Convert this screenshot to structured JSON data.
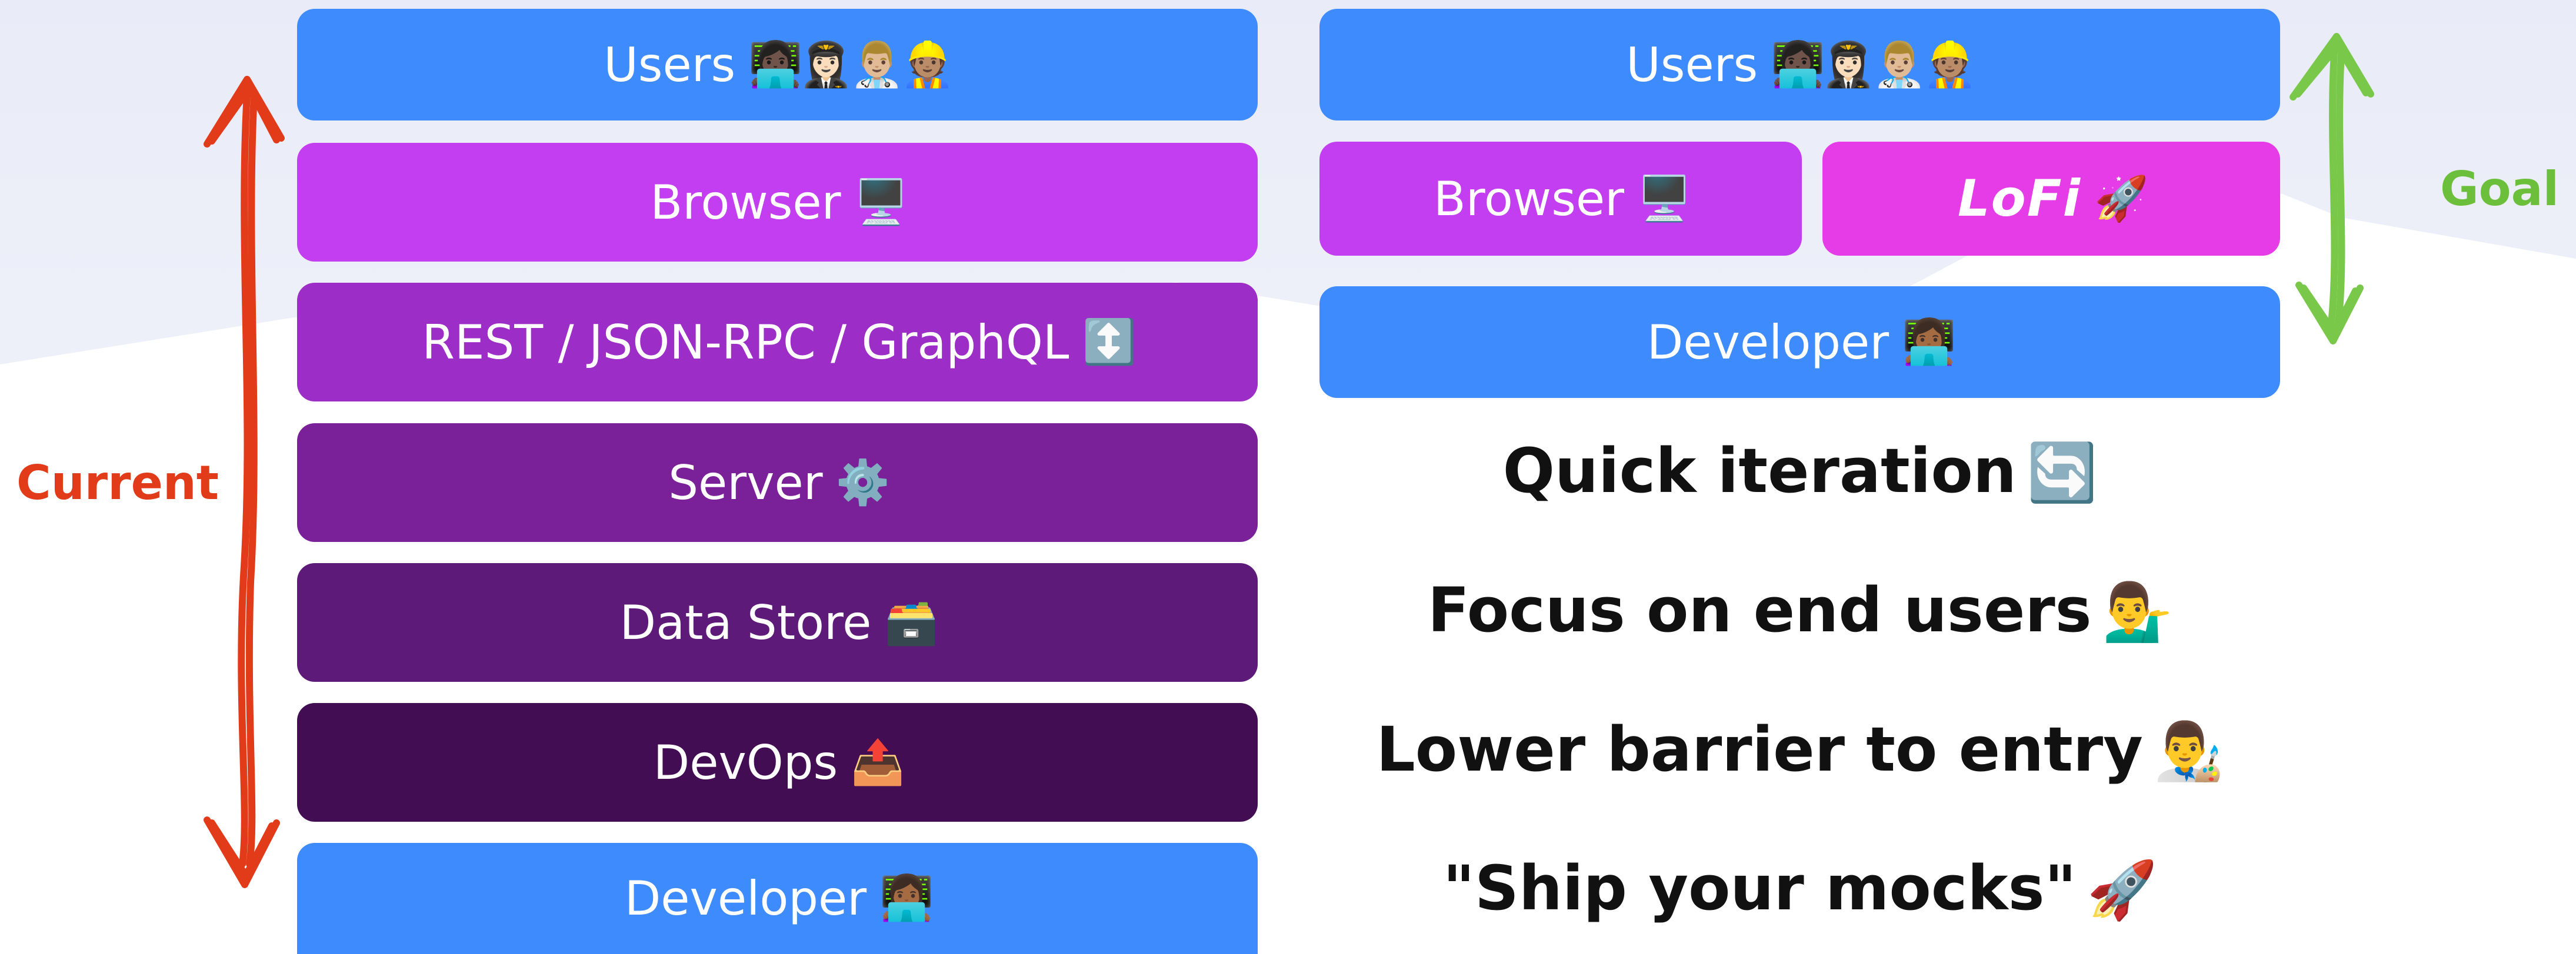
{
  "colors": {
    "blue": "#3d8bfd",
    "magenta": "#c23ef0",
    "violet_1": "#9c2ec7",
    "violet_2": "#7a2098",
    "violet_3": "#5e1a78",
    "violet_4": "#430d54",
    "pink": "#e63ce7",
    "current_red": "#e23b1a",
    "goal_green": "#6cbf3a"
  },
  "labels": {
    "current": "Current",
    "goal": "Goal"
  },
  "current_stack": [
    {
      "text": "Users",
      "emoji": "👩🏿‍💻👩🏻‍✈️👨🏼‍⚕️👷🏽"
    },
    {
      "text": "Browser",
      "emoji": "🖥️"
    },
    {
      "text": "REST / JSON-RPC / GraphQL",
      "emoji": "↕️"
    },
    {
      "text": "Server",
      "emoji": "⚙️"
    },
    {
      "text": "Data Store",
      "emoji": "🗃️"
    },
    {
      "text": "DevOps",
      "emoji": "📤"
    },
    {
      "text": "Developer",
      "emoji": "👩🏾‍💻"
    }
  ],
  "goal_stack": {
    "users": {
      "text": "Users",
      "emoji": "👩🏿‍💻👩🏻‍✈️👨🏼‍⚕️👷🏽"
    },
    "browser": {
      "text": "Browser",
      "emoji": "🖥️"
    },
    "lofi": {
      "text": "LoFi",
      "emoji": "🚀"
    },
    "developer": {
      "text": "Developer",
      "emoji": "👩🏾‍💻"
    }
  },
  "benefits": [
    {
      "text": "Quick iteration",
      "emoji": "🔄"
    },
    {
      "text": "Focus on end users",
      "emoji": "💁‍♂️"
    },
    {
      "text": "Lower barrier to entry",
      "emoji": "👨‍🎨"
    },
    {
      "text": "\"Ship your mocks\"",
      "emoji": "🚀"
    }
  ]
}
